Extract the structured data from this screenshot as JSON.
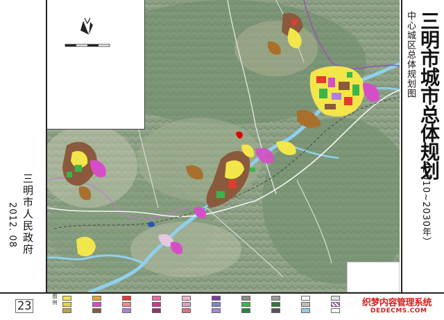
{
  "title": "三明市城市总体规划",
  "years": "（2010~2030年）",
  "subtitle": "中心城区总体规划图",
  "issuer": "三明市人民政府",
  "date": "2012. 08",
  "page_number": "23",
  "legend_heading": "图例",
  "watermark": {
    "line1": "织梦内容管理系统",
    "line2": "DEDECMS.COM"
  },
  "colors": {
    "terrain": "#7f9c7a",
    "residential": "#f2e64a",
    "commercial": "#e63a2d",
    "industrial": "#8b5a3c",
    "green": "#3bb54a",
    "admin": "#d64ec7",
    "education": "#b47ee0",
    "river": "#8fd0ec",
    "boundary": "#9b4fb2"
  },
  "map_icons": [
    "north-arrow-icon",
    "scale-bar-icon"
  ]
}
